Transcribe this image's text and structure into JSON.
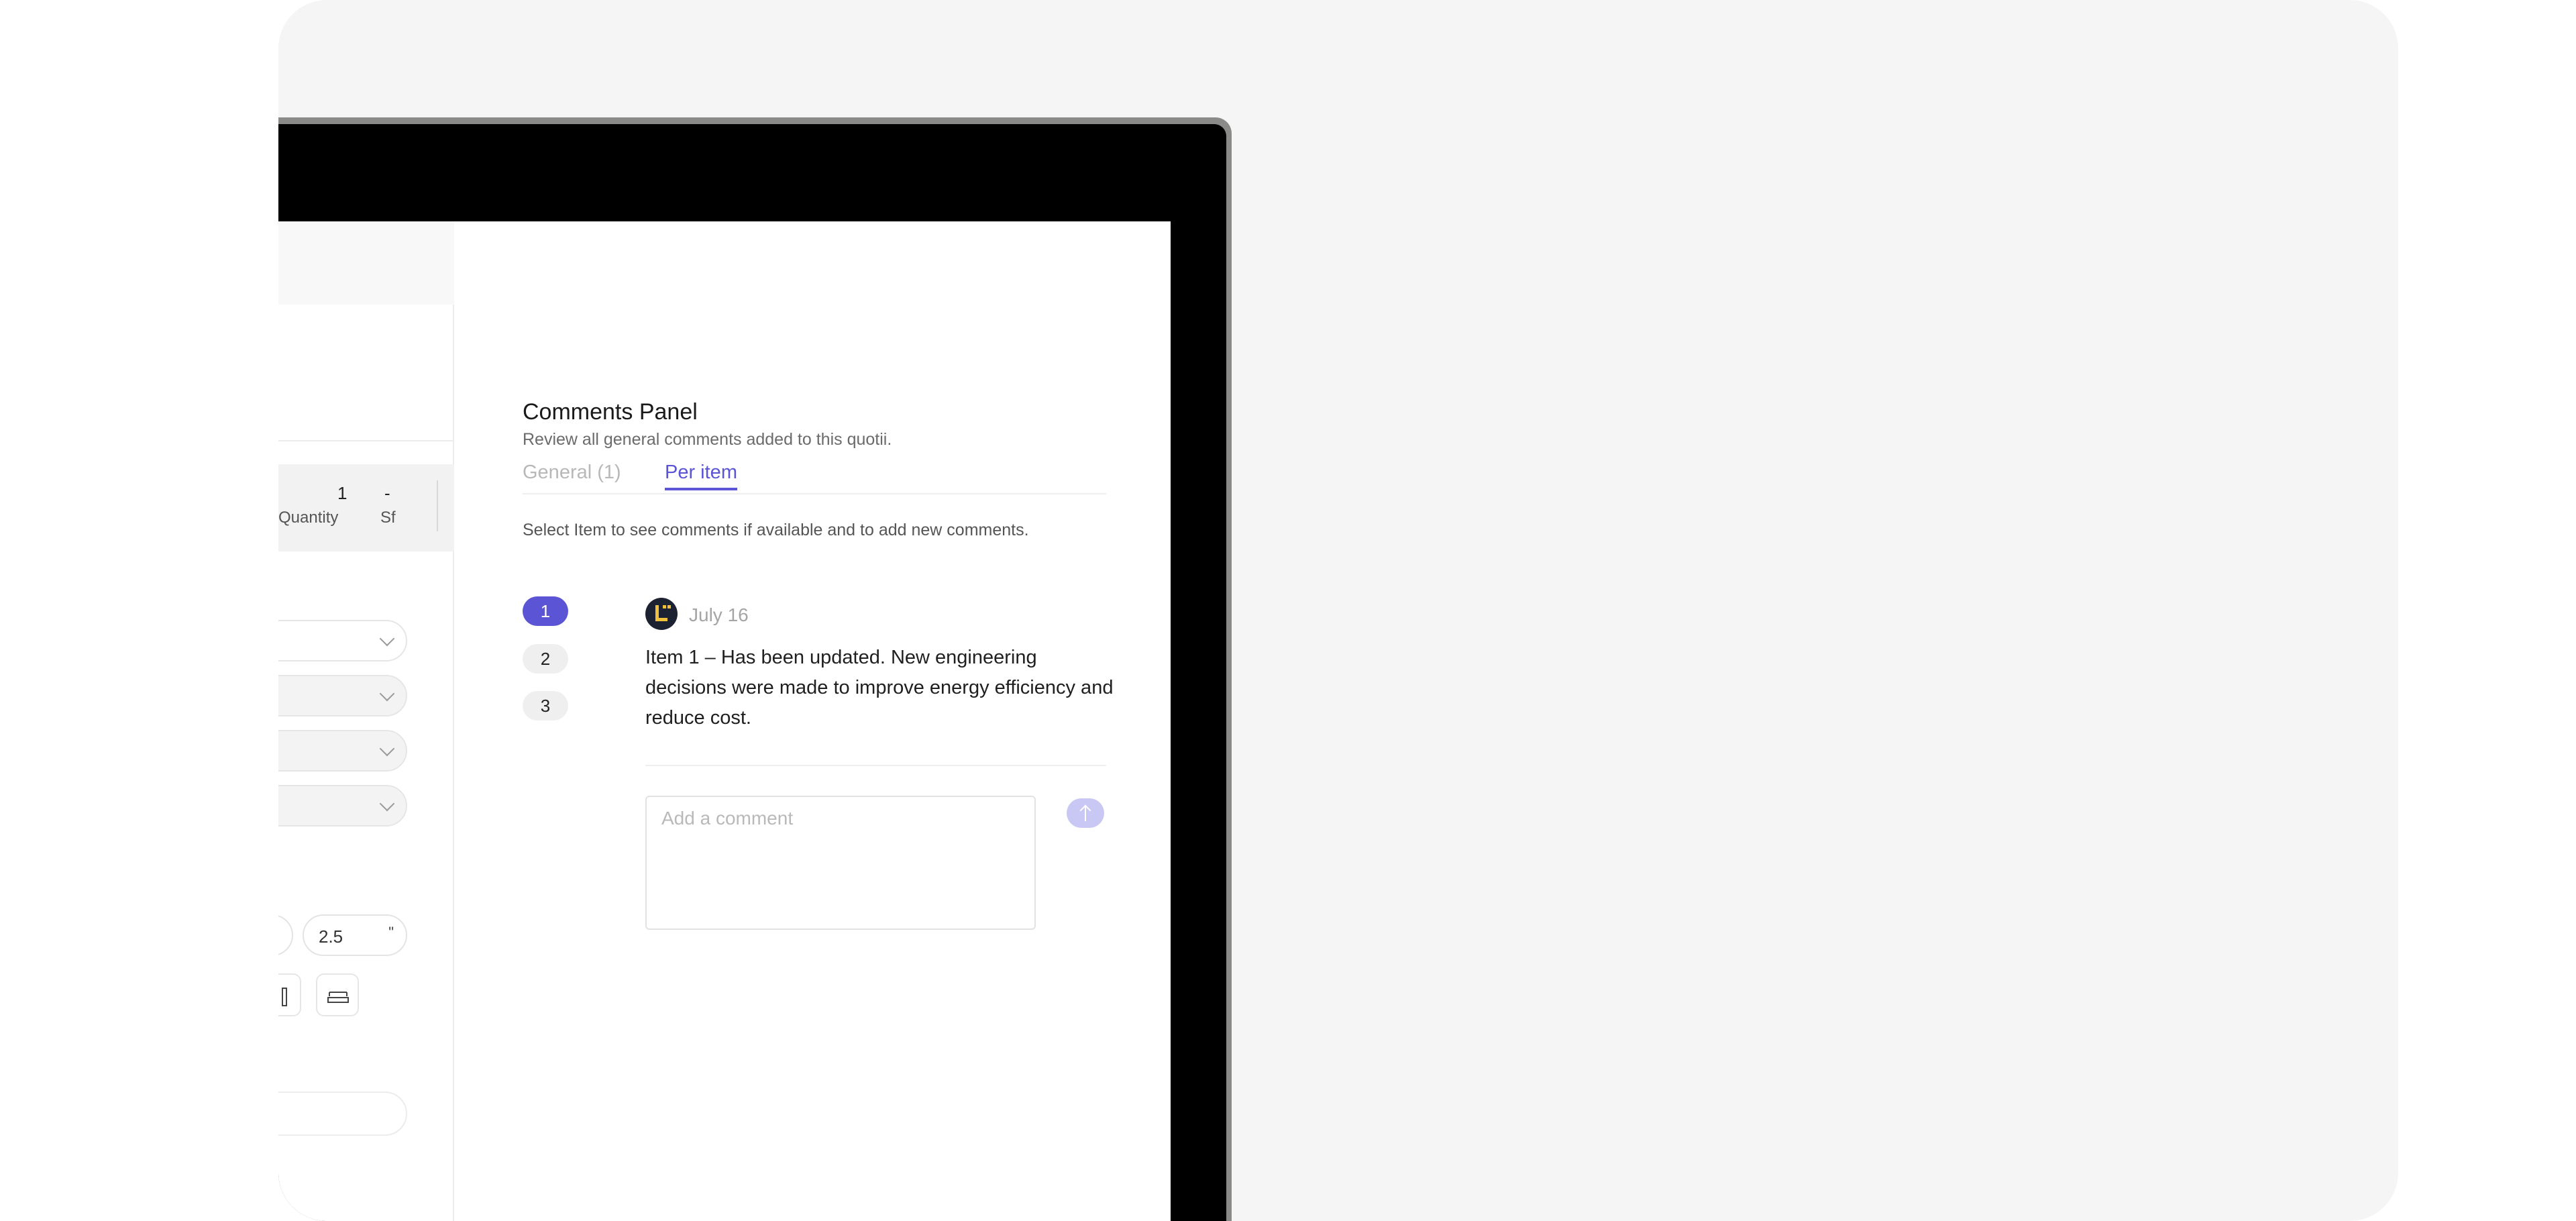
{
  "form": {
    "quantity_value": "1",
    "quantity_label": "Quantity",
    "sf_value": "-",
    "sf_label": "Sf",
    "size_value": "2.5",
    "size_unit": "\""
  },
  "comments_panel": {
    "title": "Comments Panel",
    "subtitle": "Review all general comments added to this quotii.",
    "tabs": [
      {
        "label": "General (1)",
        "active": false
      },
      {
        "label": "Per item",
        "active": true
      }
    ],
    "hint": "Select Item to see comments if available and to add new comments.",
    "items": [
      "1",
      "2",
      "3"
    ],
    "selected_item": "1",
    "comment": {
      "date": "July 16",
      "text": "Item 1 – Has been updated. New engineering decisions were made to improve energy efficiency and reduce cost."
    },
    "input": {
      "placeholder": "Add a comment",
      "value": ""
    }
  },
  "colors": {
    "accent": "#5b55d6",
    "send_button_disabled": "#c9c7f3",
    "avatar_bg": "#1d2233",
    "avatar_mark": "#f0c03c"
  }
}
